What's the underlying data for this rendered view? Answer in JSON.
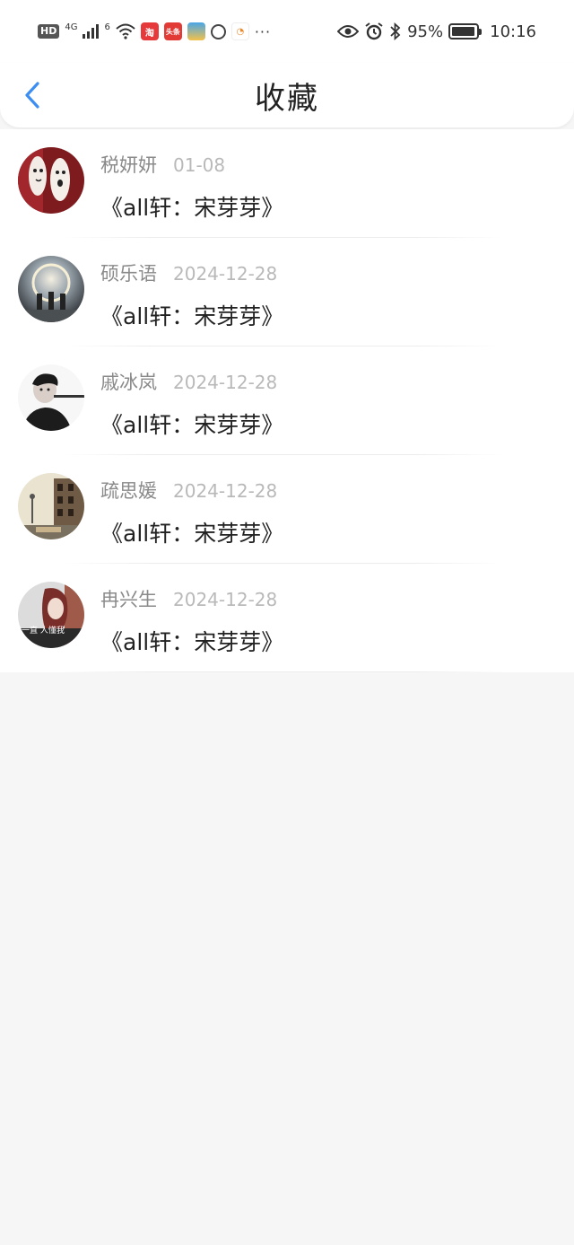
{
  "status_bar": {
    "hd": "HD",
    "network_left": "4G",
    "network_wifi": "6",
    "app_icons": [
      {
        "label": "淘",
        "color": "#e5393c"
      },
      {
        "label": "头条",
        "color": "#e23a35"
      },
      {
        "label": "",
        "color": "#48a5e8"
      }
    ],
    "battery": "95%",
    "battery_level": 0.95,
    "time": "10:16",
    "more": "···"
  },
  "header": {
    "title": "收藏",
    "accent": "#3d8ef2"
  },
  "favorites": [
    {
      "name": "税妍妍",
      "date": "01-08",
      "title": "《all轩：宋芽芽》"
    },
    {
      "name": "硕乐语",
      "date": "2024-12-28",
      "title": "《all轩：宋芽芽》"
    },
    {
      "name": "戚冰岚",
      "date": "2024-12-28",
      "title": "《all轩：宋芽芽》"
    },
    {
      "name": "疏思媛",
      "date": "2024-12-28",
      "title": "《all轩：宋芽芽》"
    },
    {
      "name": "冉兴生",
      "date": "2024-12-28",
      "title": "《all轩：宋芽芽》"
    }
  ],
  "avatar_caption": "一直 人懂我"
}
